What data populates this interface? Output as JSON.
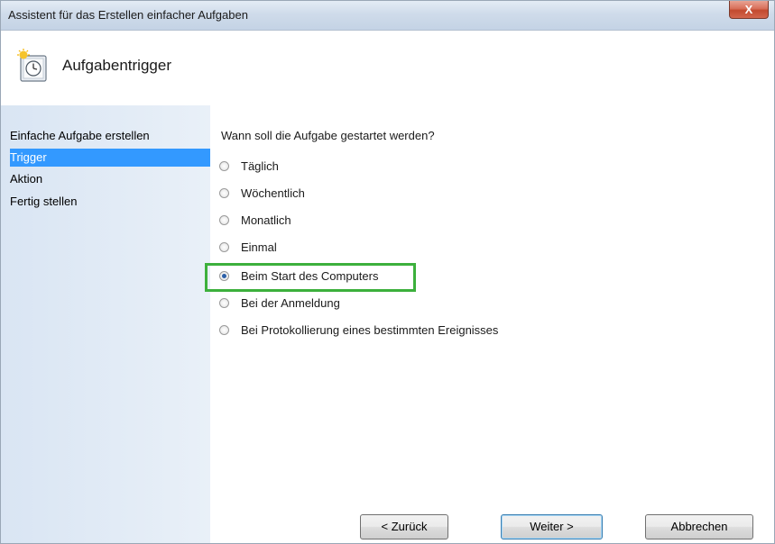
{
  "window": {
    "title": "Assistent für das Erstellen einfacher Aufgaben",
    "close_label": "X"
  },
  "header": {
    "heading": "Aufgabentrigger",
    "icon": "task-clock-icon"
  },
  "sidebar": {
    "items": [
      {
        "label": "Einfache Aufgabe erstellen",
        "active": false
      },
      {
        "label": "Trigger",
        "active": true
      },
      {
        "label": "Aktion",
        "active": false
      },
      {
        "label": "Fertig stellen",
        "active": false
      }
    ]
  },
  "main": {
    "question": "Wann soll die Aufgabe gestartet werden?",
    "options": [
      {
        "label": "Täglich",
        "checked": false
      },
      {
        "label": "Wöchentlich",
        "checked": false
      },
      {
        "label": "Monatlich",
        "checked": false
      },
      {
        "label": "Einmal",
        "checked": false
      },
      {
        "label": "Beim Start des Computers",
        "checked": true
      },
      {
        "label": "Bei der Anmeldung",
        "checked": false
      },
      {
        "label": "Bei Protokollierung eines bestimmten Ereignisses",
        "checked": false
      }
    ],
    "highlight_color": "#3cb03c"
  },
  "buttons": {
    "back": "< Zurück",
    "next": "Weiter >",
    "cancel": "Abbrechen"
  },
  "colors": {
    "selection": "#3399ff",
    "sidebar_bg": "#dfe9f5"
  }
}
